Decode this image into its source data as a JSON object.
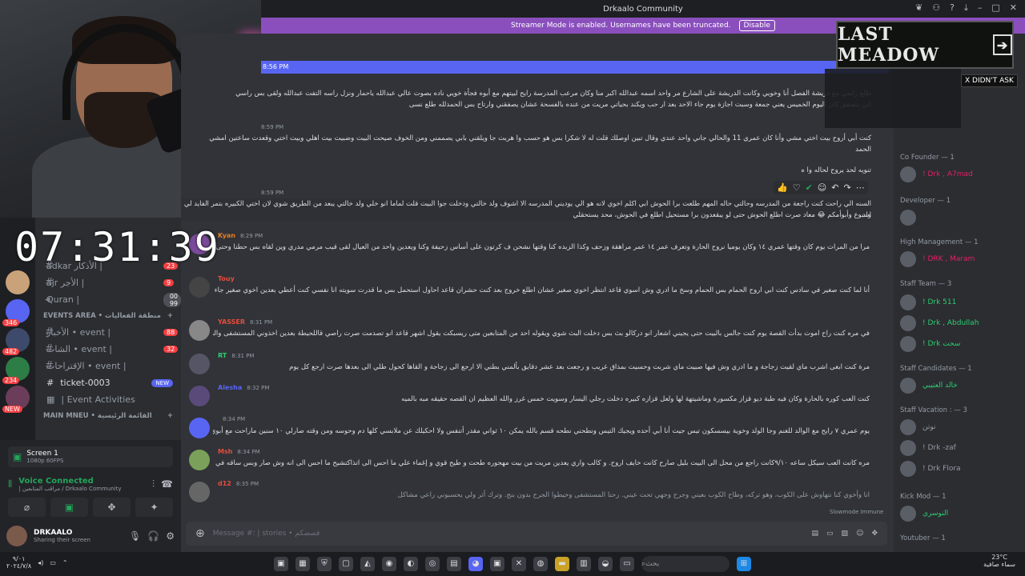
{
  "window": {
    "title": "Drkaalo Community"
  },
  "streamer": {
    "text": "Streamer Mode is enabled. Usernames have been truncated.",
    "button": "Disable"
  },
  "overlay": {
    "timer": "07:31:39",
    "ad_text": "LAST MEADOW",
    "ad_dismiss": "X DIDN'T ASK"
  },
  "sidebar": {
    "channels_top": [
      {
        "label": "| الأذكار adkar",
        "badge": "23"
      },
      {
        "label": "| الأجر ajr",
        "badge": "9"
      },
      {
        "label": "| Quran",
        "badge": "00 99"
      }
    ],
    "events_category": "EVENTS AREA • منطقة الفعاليات",
    "events": [
      {
        "label": "| event • الأخبار",
        "badge": "88"
      },
      {
        "label": "| event • الشات",
        "badge": "32"
      },
      {
        "label": "| event • الإقتراحات",
        "badge": ""
      }
    ],
    "ticket": "ticket-0003",
    "ticket_badge": "NEW",
    "event_activities": "| Event Activities",
    "main_category": "MAIN MNEU • القائمة الرئيسية",
    "servers": [
      {
        "count": "346"
      },
      {
        "count": "482"
      },
      {
        "count": "234"
      },
      {
        "count": "NEW"
      }
    ]
  },
  "voice": {
    "screen_label": "Screen 1",
    "screen_sub": "1080p 60FPS",
    "status": "Voice Connected",
    "channel": "| مراقب المتابعين / Drkaalo Community"
  },
  "user": {
    "name": "DRKAALO",
    "status": "Sharing their screen"
  },
  "chat": {
    "new_divider_time": "8:56 PM",
    "top_texts": [
      "طلع راسي مع دريشة الفصل أنا وخويي وكانت الدريشة على الشارع مر واحد اسمه عبدالله اكبر منا وكان مرعب المدرسة رايح لبيتهم مع أبوه فجأة خويي ناده بصوت عالي عبدالله ياحمار ونزل راسه التفت عبدالله ولقى بس راسي",
      "اني بتصفق كان اليوم الخميس يعني جمعة وسبت اجازة يوم جاء الاحد بعد ار حب ويكند بحياتي مريت من عنده بالفسحة عشان يصفقني وارتاح بس الحمدلله طلع نسى",
      "كنت أبي أروح بيت اختي مشي وأنا كان عمري 11 والحالي جاني واحد عندي وقال تبين اوصلك قلت له لا شكرا بس هو حسب وا هربت جا ويلقني بابي يصممني ومن الخوف صيحت البيت وضبيت بيت اهلي وبيت اختي وقعدت ساعتين امشي",
      "الحمد",
      "تنويه لحد يروح لحاله وا ه",
      "السنه الي راحت كنت راجعة من المدرسه وحالتي حاله المهم طلعت برا الحوش ابي اكلم اخوي لانه هو الي يوديني المدرسه الا اشوف ولد خالتي ودخلت جوا البيت قلت لماما انو خلي ولد خالتي يبعد من الطريق شوي لان اختي الكبيره بتمر الفايد لي ولد",
      "اسبوع وأبوأمكم 😂 معاد صرت اطلع الحوش حتى لو يبقعدون برا مستحيل اطلع في الحوش، محد يستحقلي"
    ],
    "top_times": [
      "8:59 PM",
      "8:59 PM",
      "8:29 PM"
    ],
    "messages": [
      {
        "name": "Kyan",
        "time": "8:29 PM",
        "text": "مرا من المرات يوم كان وقتها عمري ١٤ وكان يوميا نروح الحارة وتعرف عمر ١٤ عمر مراهقة وزحف وكذا الزبده كنا وقتها نشحن ف كرتون على أساس زحيفة وكنا ويعدين واحد من العيال لقى قيب مرمي مدري وين لقاه بس حطنا وحتى كنا حمير المشكلة القيب"
      },
      {
        "name": "Touy",
        "time": "",
        "text": "أنا لما كنت صغير في سادس كنت ابي اروح الحمام بس الحمام وسخ ما ادري وش اسوي قاعد انتظر اخوي صغير عشان اطلع خروج بعد كنت حشران قاعد احاول استحمل بس ما قدرت سويته انا نفسي كنت أعطي بعدين اخوي صغير جاء يقول ايش"
      },
      {
        "name": "YASSER",
        "time": "8:31 PM",
        "text": "في مره كنت راح اموت بدأت القصة يوم كنت جالس بالبيت حتى يجيني اشعار انو دركالو بث بس دخلت البث شوي ويقوله احد من المتابعين متى ريسبكت يقول اشهر قاعد انو تصدمت صرت راصي قاللحيطة بعدين اخذوني المستشفى والحمدلله لحين بخير اطمنكم"
      },
      {
        "name": "RT",
        "time": "8:31 PM",
        "text": "مرة كنت ابغى اشرب ماي لقيت زجاجة و ما ادري وش فيها صبيت ماي شربت وحسيت بمذاق غريب و رجعت بعد عشر دقايق بألمني بطني الا ارجع الى زجاجة و القاها كحول طلي الى بعدها صرت ارجع كل يوم"
      },
      {
        "name": "Alesha",
        "time": "8:32 PM",
        "text": "كنت العب كوره بالحارة وكان فيه طبة ديو قزاز مكسورة وماشيتهة لها ولعل قزازه كبيره دخلت رجلي اليسار وسويت خمس غرز والله العظيم ان القصه حقيقه مبه بالميه"
      },
      {
        "name": "",
        "time": "8:34 PM",
        "text": "يوم عمري ٧ رايح مع الوالد للغنم وجا الولد وخوية بيسسكون تيس جيت أنا أبي أحده ويجيك التيس ونطحني نطحه قسم بالله يمكن ١٠ ثواني مقدر أتنفس ولا احكيلك عن ملابسي كلها دم وحوسه ومن وقته صارلي ١٠ سنين ماراحت مع أبوي للغنم وبس"
      },
      {
        "name": "Msh",
        "time": "8:34 PM",
        "text": "مره كانت العب سيكل ساعه ٩/١٠كانت راجع من محل الى البيت بليل صارح كانت خايف اروح. و كالب واري يعدين مريت من بيت مهجوره طحت و طيح قوي و إغماء علي ما احس الى اتذاكتشيح ما احس الى انه وش صار وبس ساقه في ديره قبل دسنوات"
      },
      {
        "name": "d12",
        "time": "8:35 PM",
        "text": "انا وأخوي كنا نتهاوش على الكوب، وهو تركه، وطاح الكوب بعيني وجرح وجهي تحت عيني. رحنا المستشفى وخيطوا الجرح بدون بنج. وترك أثر ولي يحسبوني راعي مشاكل"
      }
    ],
    "slowmode": "Slowmode Immune",
    "composer_placeholder": "Message #؛ | stories • قصصكم"
  },
  "members": {
    "categories": [
      {
        "label": "Co Founder — 1",
        "members": [
          "! Drk , A7mad"
        ]
      },
      {
        "label": "Developer — 1",
        "members": [
          ""
        ]
      },
      {
        "label": "High Management — 1",
        "members": [
          "! DRK , Maram"
        ]
      },
      {
        "label": "Staff Team — 3",
        "members": [
          "! Drk 511",
          "! Drk , Abdullah",
          "! Drk سحت"
        ]
      },
      {
        "label": "Staff Candidates — 1",
        "members": [
          "خالد العتيبي"
        ]
      },
      {
        "label": "Staff Vacation : — 3",
        "members": [
          "نوتن",
          "! Drk -zaf",
          "! Drk Flora"
        ]
      },
      {
        "label": "Kick Mod — 1",
        "members": [
          "النوسري"
        ]
      },
      {
        "label": "Youtuber — 1",
        "members": []
      }
    ]
  },
  "taskbar": {
    "search": "بحث",
    "weather": "23°C",
    "weather_sub": "سماء صافية",
    "time": "٩/٠١",
    "date": "٢٠٢٤/٧/٨"
  }
}
